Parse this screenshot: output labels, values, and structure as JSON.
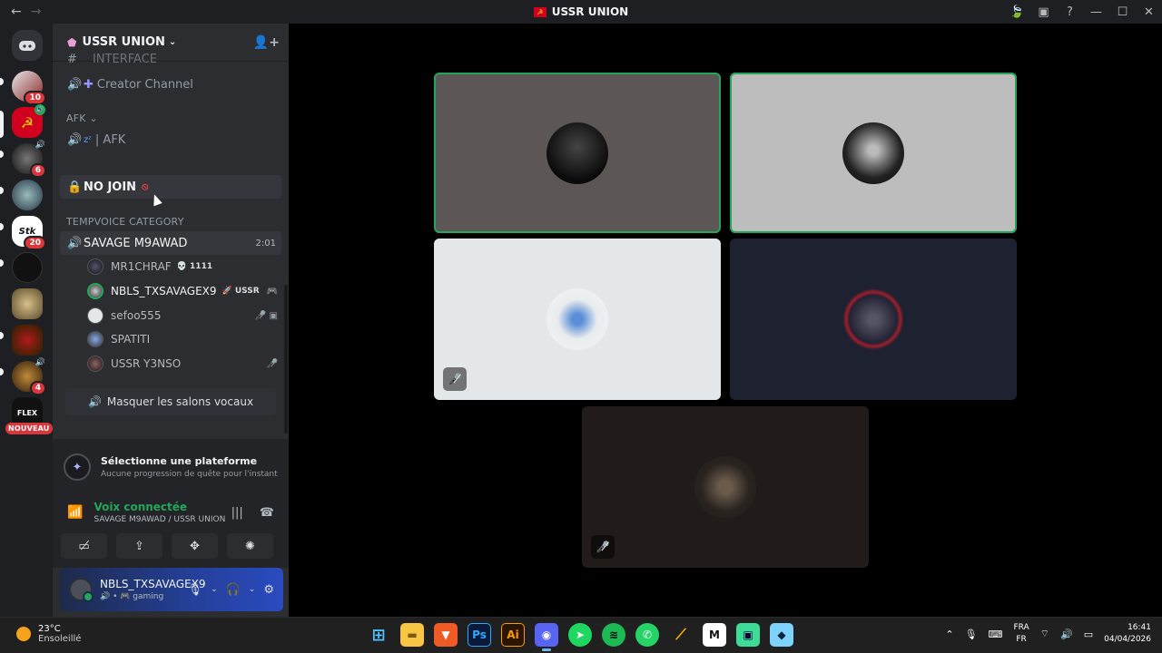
{
  "window": {
    "title": "USSR UNION",
    "nav": {
      "back": "←",
      "forward": "→"
    },
    "controls": {
      "quest": "🍃",
      "inbox": "▣",
      "help": "?",
      "minimize": "—",
      "maximize": "☐",
      "close": "✕"
    }
  },
  "guilds": [
    {
      "name": "discord-home",
      "badge": ""
    },
    {
      "name": "guild-1",
      "badge": "10"
    },
    {
      "name": "guild-ussr",
      "badge": ""
    },
    {
      "name": "guild-3",
      "badge": "6"
    },
    {
      "name": "guild-4",
      "badge": ""
    },
    {
      "name": "guild-stake",
      "badge": "20"
    },
    {
      "name": "guild-6",
      "badge": ""
    },
    {
      "name": "guild-7",
      "badge": ""
    },
    {
      "name": "guild-8",
      "badge": ""
    },
    {
      "name": "guild-9",
      "badge": "4"
    },
    {
      "name": "guild-flex",
      "badge": ""
    }
  ],
  "new_badge": "NOUVEAU",
  "server": {
    "name": "USSR UNION",
    "chevron": "⌄",
    "invite_icon": "👤+"
  },
  "channels": {
    "partial_top": "INTERFACE",
    "creator": "Creator Channel",
    "afk_category": "AFK",
    "afk_channel": "| AFK",
    "no_join": "NO JOIN",
    "temp_category": "TEMPVOICE CATEGORY",
    "active_channel": "SAVAGE M9AWAD",
    "active_timer": "2:01"
  },
  "members": [
    {
      "name": "MR1CHRAF",
      "tag": "💀 1111",
      "icon": ""
    },
    {
      "name": "NBLS_TXSAVAGEX9",
      "tag": "🚀 USSR",
      "icon": "🎮"
    },
    {
      "name": "sefoo555",
      "tag": "",
      "icon": "🎤̸ ▣"
    },
    {
      "name": "SPATITI",
      "tag": "",
      "icon": ""
    },
    {
      "name": "USSR Y3NSO",
      "tag": "",
      "icon": "🎤̸"
    }
  ],
  "hide_voice_label": "Masquer les salons vocaux",
  "quest": {
    "title": "Sélectionne une plateforme",
    "subtitle": "Aucune progression de quête pour l'instant"
  },
  "voice": {
    "status": "Voix connectée",
    "location": "SAVAGE M9AWAD / USSR UNION"
  },
  "user": {
    "name": "NBLS_TXSAVAGEX9",
    "status": "🔊 • 🎮 gaming"
  },
  "tiles": [
    {
      "name": "tile-user-1",
      "bg": "#5d5656",
      "speaking": true,
      "muted": false
    },
    {
      "name": "tile-user-2",
      "bg": "#bdbdbd",
      "speaking": true,
      "muted": false
    },
    {
      "name": "tile-user-3",
      "bg": "#e4e7e9",
      "speaking": false,
      "muted": true
    },
    {
      "name": "tile-user-4",
      "bg": "#1e2130",
      "speaking": false,
      "muted": false
    },
    {
      "name": "tile-user-5",
      "bg": "#211c1a",
      "speaking": false,
      "muted": true
    }
  ],
  "taskbar": {
    "temp": "23°C",
    "weather": "Ensoleillé",
    "lang_top": "FRA",
    "lang_bottom": "FR",
    "time": "16:41",
    "date": "04/04/2026"
  },
  "colors": {
    "accent_green": "#23a55a",
    "badge_red": "#da373c",
    "blurple": "#5865f2"
  }
}
